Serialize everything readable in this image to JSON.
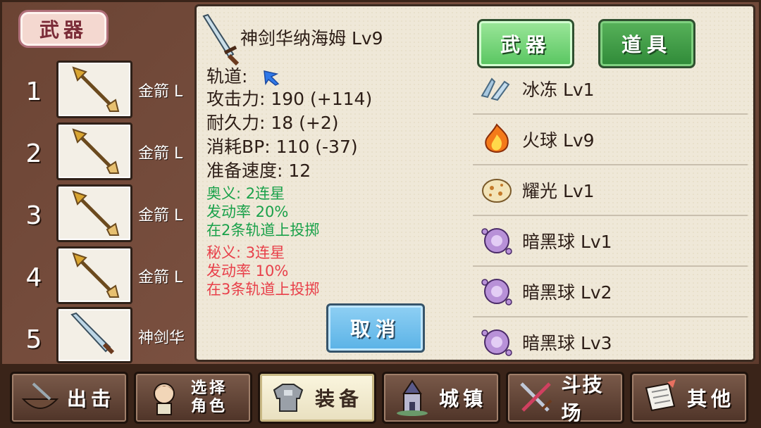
{
  "left_panel": {
    "header": "武器",
    "slots": [
      {
        "num": "1",
        "name": "金箭 L"
      },
      {
        "num": "2",
        "name": "金箭 L"
      },
      {
        "num": "3",
        "name": "金箭 L"
      },
      {
        "num": "4",
        "name": "金箭 L"
      },
      {
        "num": "5",
        "name": "神剑华"
      }
    ]
  },
  "detail": {
    "title": "神剑华纳海姆 Lv9",
    "track_label": "轨道:",
    "attack": "攻击力: 190 (+114)",
    "durability": "耐久力: 18 (+2)",
    "bp_cost": "消耗BP: 110 (-37)",
    "prep_speed": "准备速度: 12",
    "secret_a_name": "奥义: 2连星",
    "secret_a_rate": "发动率 20%",
    "secret_a_desc": "在2条轨道上投掷",
    "secret_b_name": "秘义: 3连星",
    "secret_b_rate": "发动率 10%",
    "secret_b_desc": "在3条轨道上投掷",
    "cancel_label": "取消"
  },
  "tabs": {
    "weapon_label": "武器",
    "items_label": "道具"
  },
  "skills": [
    {
      "name": "冰冻 Lv1",
      "icon": "ice-icon"
    },
    {
      "name": "火球 Lv9",
      "icon": "fireball-icon"
    },
    {
      "name": "耀光 Lv1",
      "icon": "flash-icon"
    },
    {
      "name": "暗黑球 Lv1",
      "icon": "dark-orb-icon"
    },
    {
      "name": "暗黑球 Lv2",
      "icon": "dark-orb-icon"
    },
    {
      "name": "暗黑球 Lv3",
      "icon": "dark-orb-icon"
    }
  ],
  "nav": [
    {
      "label": "出击"
    },
    {
      "label": "选择\n角色"
    },
    {
      "label": "装备"
    },
    {
      "label": "城镇"
    },
    {
      "label": "斗技场"
    },
    {
      "label": "其他"
    }
  ],
  "colors": {
    "accent_green": "#1aa14a",
    "accent_red": "#e8404a",
    "cancel_blue": "#5ab2e6",
    "tab_green": "#58c560"
  }
}
